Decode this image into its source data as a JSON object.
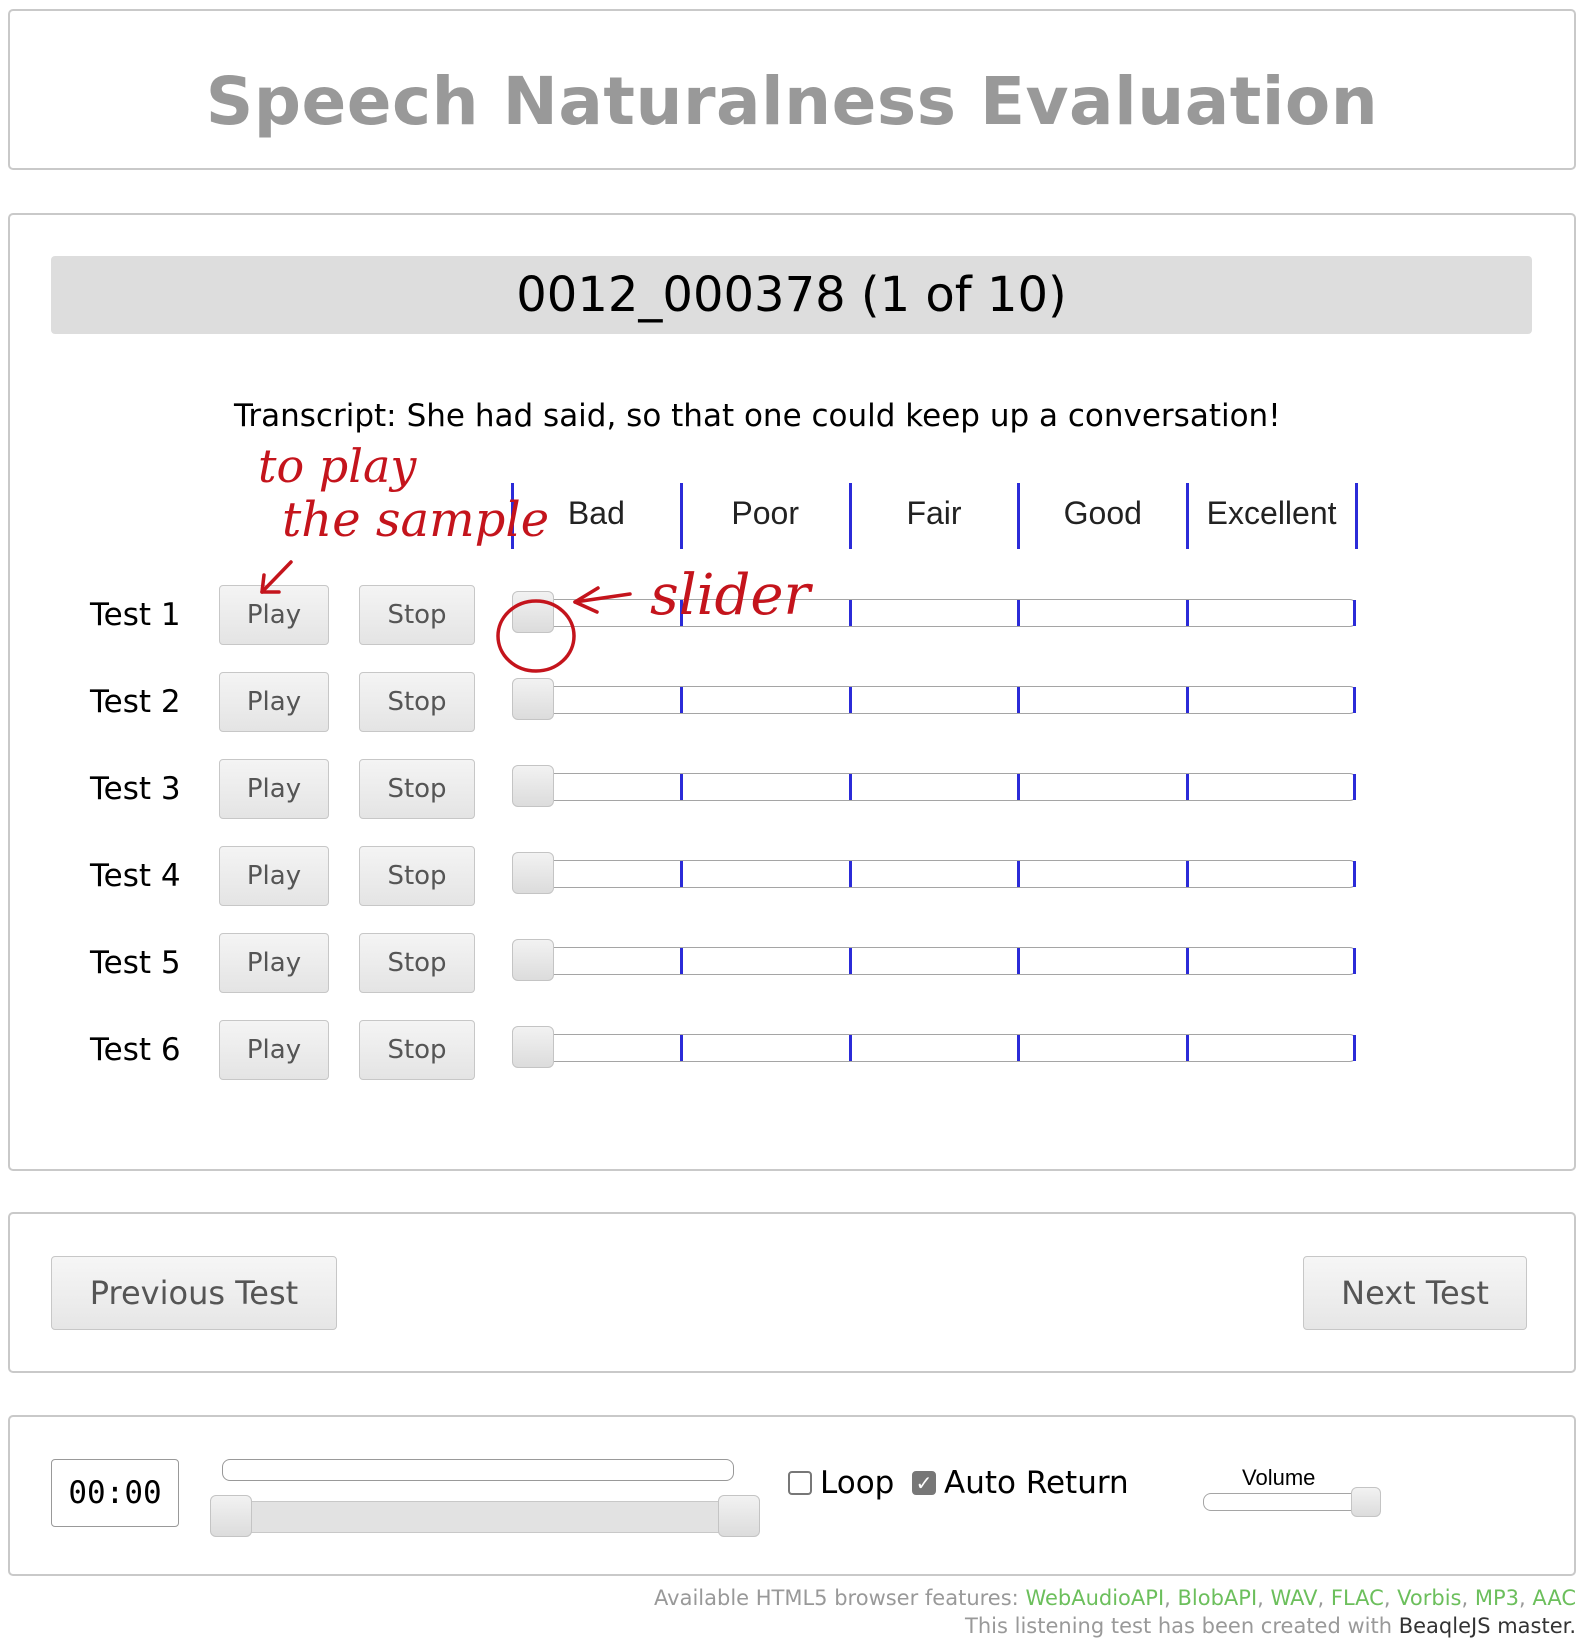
{
  "title": "Speech Naturalness Evaluation",
  "test": {
    "header": "0012_000378 (1 of 10)",
    "transcript_label": "Transcript:",
    "transcript_text": "She had said, so that one could keep up a conversation!",
    "scale": [
      "Bad",
      "Poor",
      "Fair",
      "Good",
      "Excellent"
    ],
    "play_label": "Play",
    "stop_label": "Stop",
    "rows": [
      {
        "label": "Test 1",
        "rating": 0
      },
      {
        "label": "Test 2",
        "rating": 0
      },
      {
        "label": "Test 3",
        "rating": 0
      },
      {
        "label": "Test 4",
        "rating": 0
      },
      {
        "label": "Test 5",
        "rating": 0
      },
      {
        "label": "Test 6",
        "rating": 0
      }
    ]
  },
  "annotations": {
    "play_note_line1": "to play",
    "play_note_line2": "the sample",
    "slider_note": "slider",
    "color": "#c4141c"
  },
  "nav": {
    "previous": "Previous Test",
    "next": "Next Test"
  },
  "player": {
    "time": "00:00",
    "loop_label": "Loop",
    "loop_checked": false,
    "auto_return_label": "Auto Return",
    "auto_return_checked": true,
    "volume_label": "Volume",
    "volume_level": 1.0
  },
  "footer": {
    "features_prefix": "Available HTML5 browser features:",
    "features": [
      "WebAudioAPI",
      "BlobAPI",
      "WAV",
      "FLAC",
      "Vorbis",
      "MP3",
      "AAC"
    ],
    "credit_prefix": "This listening test has been created with",
    "credit_link": "BeaqleJS master."
  },
  "colors": {
    "accent_tick": "#2b2bd8",
    "feature_green": "#6cbf5c",
    "title_gray": "#999999"
  }
}
